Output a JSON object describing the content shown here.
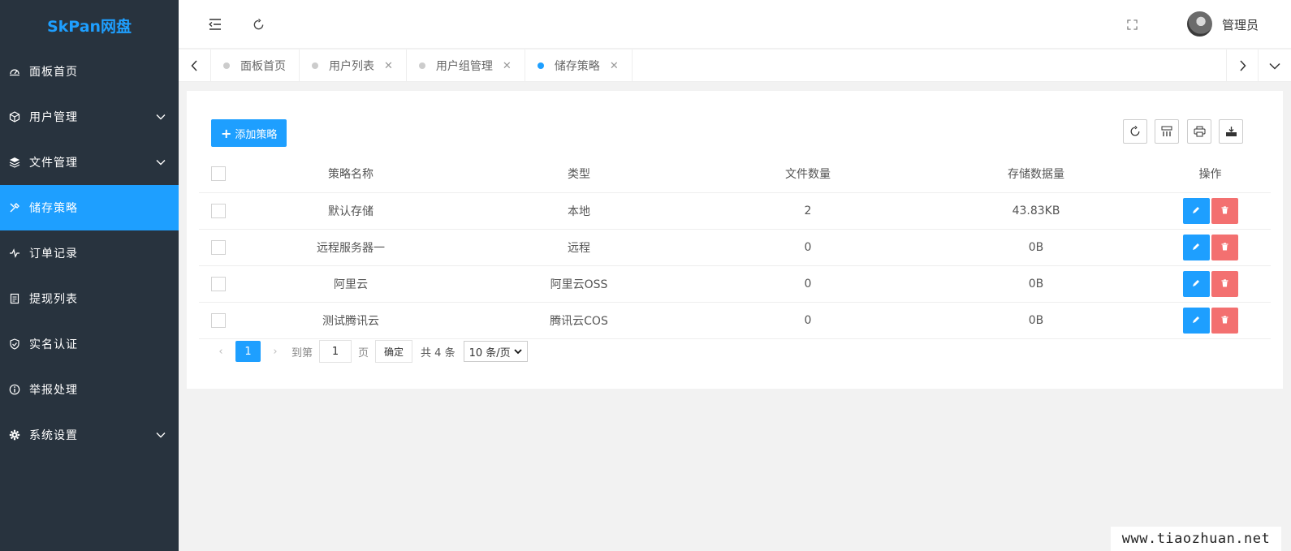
{
  "app": {
    "logo": "SkPan网盘"
  },
  "sidebar": {
    "items": [
      {
        "label": "面板首页",
        "icon": "dashboard-icon",
        "has_arrow": false
      },
      {
        "label": "用户管理",
        "icon": "cube-icon",
        "has_arrow": true
      },
      {
        "label": "文件管理",
        "icon": "layers-icon",
        "has_arrow": true
      },
      {
        "label": "储存策略",
        "icon": "tools-icon",
        "has_arrow": false,
        "active": true
      },
      {
        "label": "订单记录",
        "icon": "pulse-icon",
        "has_arrow": false
      },
      {
        "label": "提现列表",
        "icon": "clipboard-icon",
        "has_arrow": false
      },
      {
        "label": "实名认证",
        "icon": "shield-icon",
        "has_arrow": false
      },
      {
        "label": "举报处理",
        "icon": "info-icon",
        "has_arrow": false
      },
      {
        "label": "系统设置",
        "icon": "gear-icon",
        "has_arrow": true
      }
    ]
  },
  "header": {
    "username": "管理员"
  },
  "tabs": [
    {
      "label": "面板首页",
      "closable": false,
      "active": false
    },
    {
      "label": "用户列表",
      "closable": true,
      "active": false
    },
    {
      "label": "用户组管理",
      "closable": true,
      "active": false
    },
    {
      "label": "储存策略",
      "closable": true,
      "active": true
    }
  ],
  "toolbar": {
    "add_label": "添加策略"
  },
  "table": {
    "headers": [
      "策略名称",
      "类型",
      "文件数量",
      "存储数据量",
      "操作"
    ],
    "rows": [
      [
        "默认存储",
        "本地",
        "2",
        "43.83KB"
      ],
      [
        "远程服务器一",
        "远程",
        "0",
        "0B"
      ],
      [
        "阿里云",
        "阿里云OSS",
        "0",
        "0B"
      ],
      [
        "测试腾讯云",
        "腾讯云COS",
        "0",
        "0B"
      ]
    ]
  },
  "pager": {
    "current": "1",
    "goto_prefix": "到第",
    "goto_value": "1",
    "goto_suffix": "页",
    "confirm": "确定",
    "total": "共 4 条",
    "page_size": "10 条/页"
  },
  "watermark": "www.tiaozhuan.net",
  "colors": {
    "accent": "#1e9fff",
    "sidebar": "#28333e",
    "danger": "#f37070"
  }
}
